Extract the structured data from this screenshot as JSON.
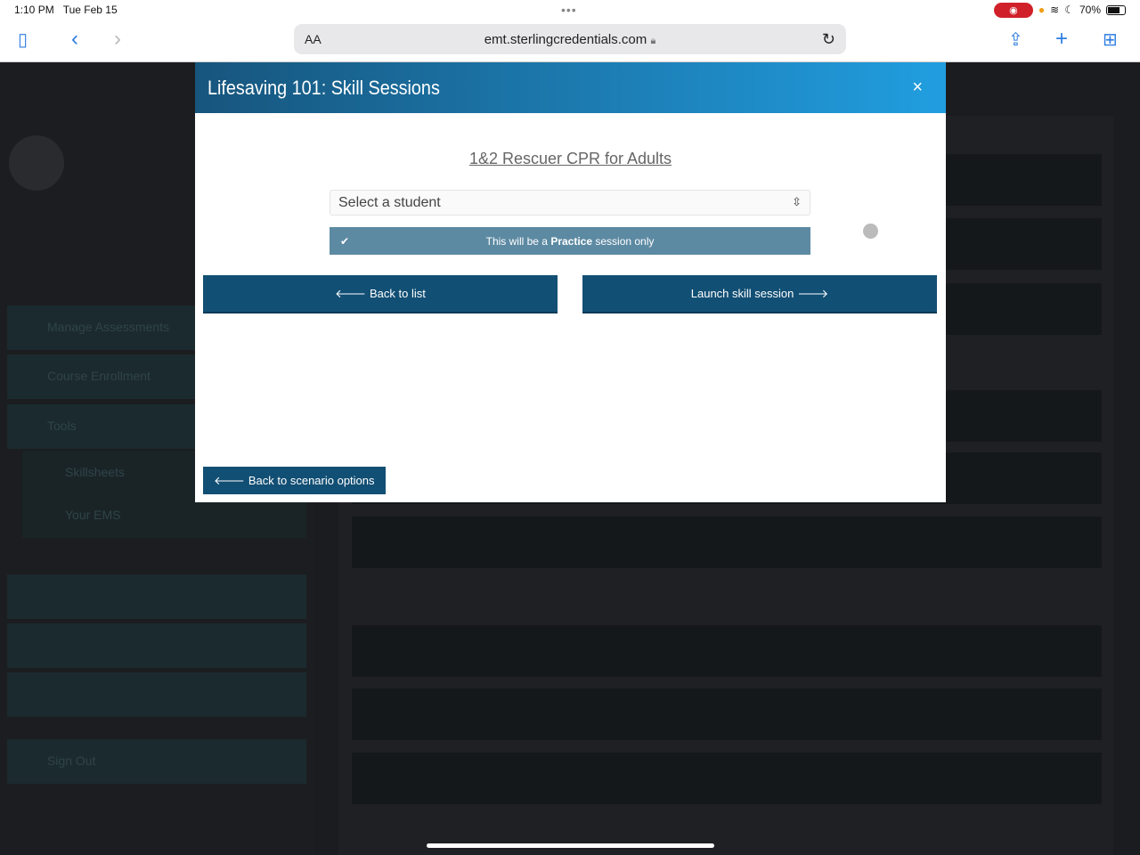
{
  "status_bar": {
    "time": "1:10 PM",
    "date": "Tue Feb 15",
    "battery": "70%",
    "battery_level": 0.7
  },
  "browser": {
    "text_size": "AA",
    "url": "emt.sterlingcredentials.com",
    "icons": [
      "sidebar-icon",
      "back-icon",
      "forward-icon",
      "lock-icon",
      "reload-icon",
      "share-icon",
      "new-tab-icon",
      "tabs-icon"
    ]
  },
  "background": {
    "sidebar_items": [
      "Manage Assessments",
      "Course Enrollment",
      "Tools",
      "Skillsheets",
      "Your EMS",
      "Sign Out"
    ]
  },
  "modal": {
    "title": "Lifesaving 101: Skill Sessions",
    "close": "×",
    "scenario": "1&2 Rescuer CPR for Adults",
    "student_select": {
      "value": "Select a student"
    },
    "practice": {
      "pre": "This will be a ",
      "bold": "Practice",
      "post": " session only",
      "checked": true
    },
    "back_to_list": "Back to list",
    "launch": "Launch skill session",
    "back_to_scenarios": "Back to scenario options",
    "colors": {
      "header_start": "#17557d",
      "header_end": "#219ee0",
      "button": "#124f74",
      "practice": "#5d8aa3"
    }
  }
}
